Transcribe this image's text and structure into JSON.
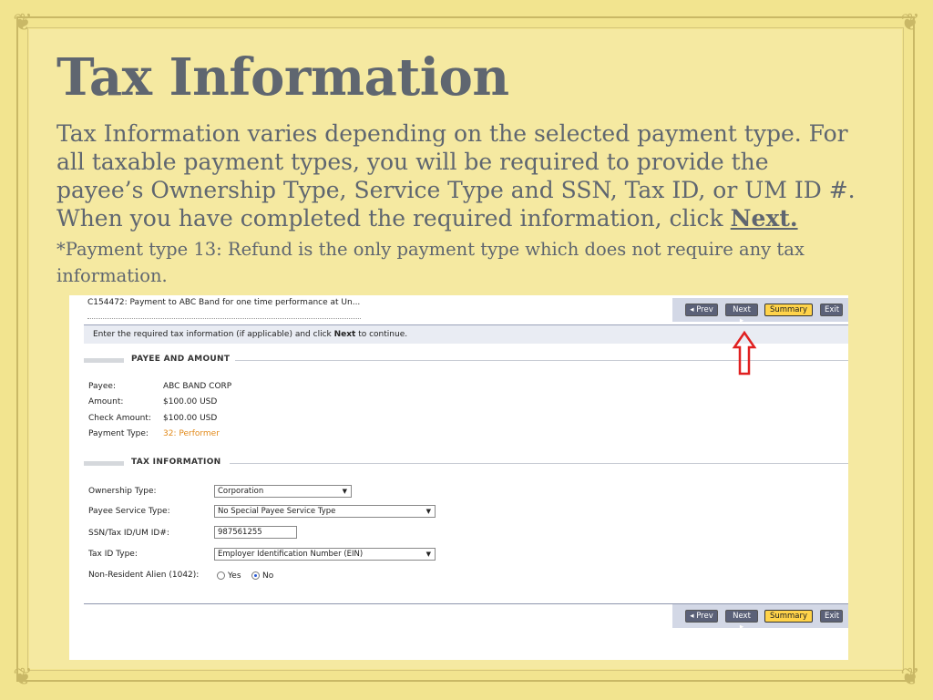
{
  "slide": {
    "title": "Tax Information",
    "intro": "Tax Information varies depending on the selected payment type. For all taxable payment types, you will be required to provide the payee’s Ownership Type, Service Type and SSN, Tax ID, or UM ID #. When you have completed the required information, click ",
    "intro_next": "Next.",
    "note": "*Payment type 13: Refund is the only payment type which does not require any tax information."
  },
  "screen": {
    "header": "C154472: Payment to ABC Band for one time performance at Un...",
    "buttons": {
      "prev": "◂ Prev",
      "next": "Next ▸",
      "summary": "Summary",
      "exit": "Exit"
    },
    "instruction_pre": "Enter the required tax information (if applicable) and click ",
    "instruction_bold": "Next",
    "instruction_post": " to continue.",
    "payee_section": "PAYEE AND AMOUNT",
    "payee": {
      "payee_label": "Payee:",
      "payee_value": "ABC BAND CORP",
      "amount_label": "Amount:",
      "amount_value": "$100.00 USD",
      "check_label": "Check Amount:",
      "check_value": "$100.00 USD",
      "type_label": "Payment Type:",
      "type_value": "32: Performer"
    },
    "tax_section": "TAX INFORMATION",
    "tax": {
      "ownership_label": "Ownership Type:",
      "ownership_value": "Corporation",
      "service_label": "Payee Service Type:",
      "service_value": "No Special Payee Service Type",
      "ssn_label": "SSN/Tax ID/UM ID#:",
      "ssn_value": "987561255",
      "taxid_type_label": "Tax ID Type:",
      "taxid_type_value": "Employer Identification Number (EIN)",
      "alien_label": "Non-Resident Alien (1042):",
      "yes_label": "Yes",
      "no_label": "No",
      "alien_selected": "No"
    }
  },
  "colors": {
    "background": "#f2e48f",
    "title_text": "#5f6670",
    "summary_button": "#ffd34a",
    "nav_button": "#5b6178",
    "annotation_arrow": "#e02020"
  }
}
